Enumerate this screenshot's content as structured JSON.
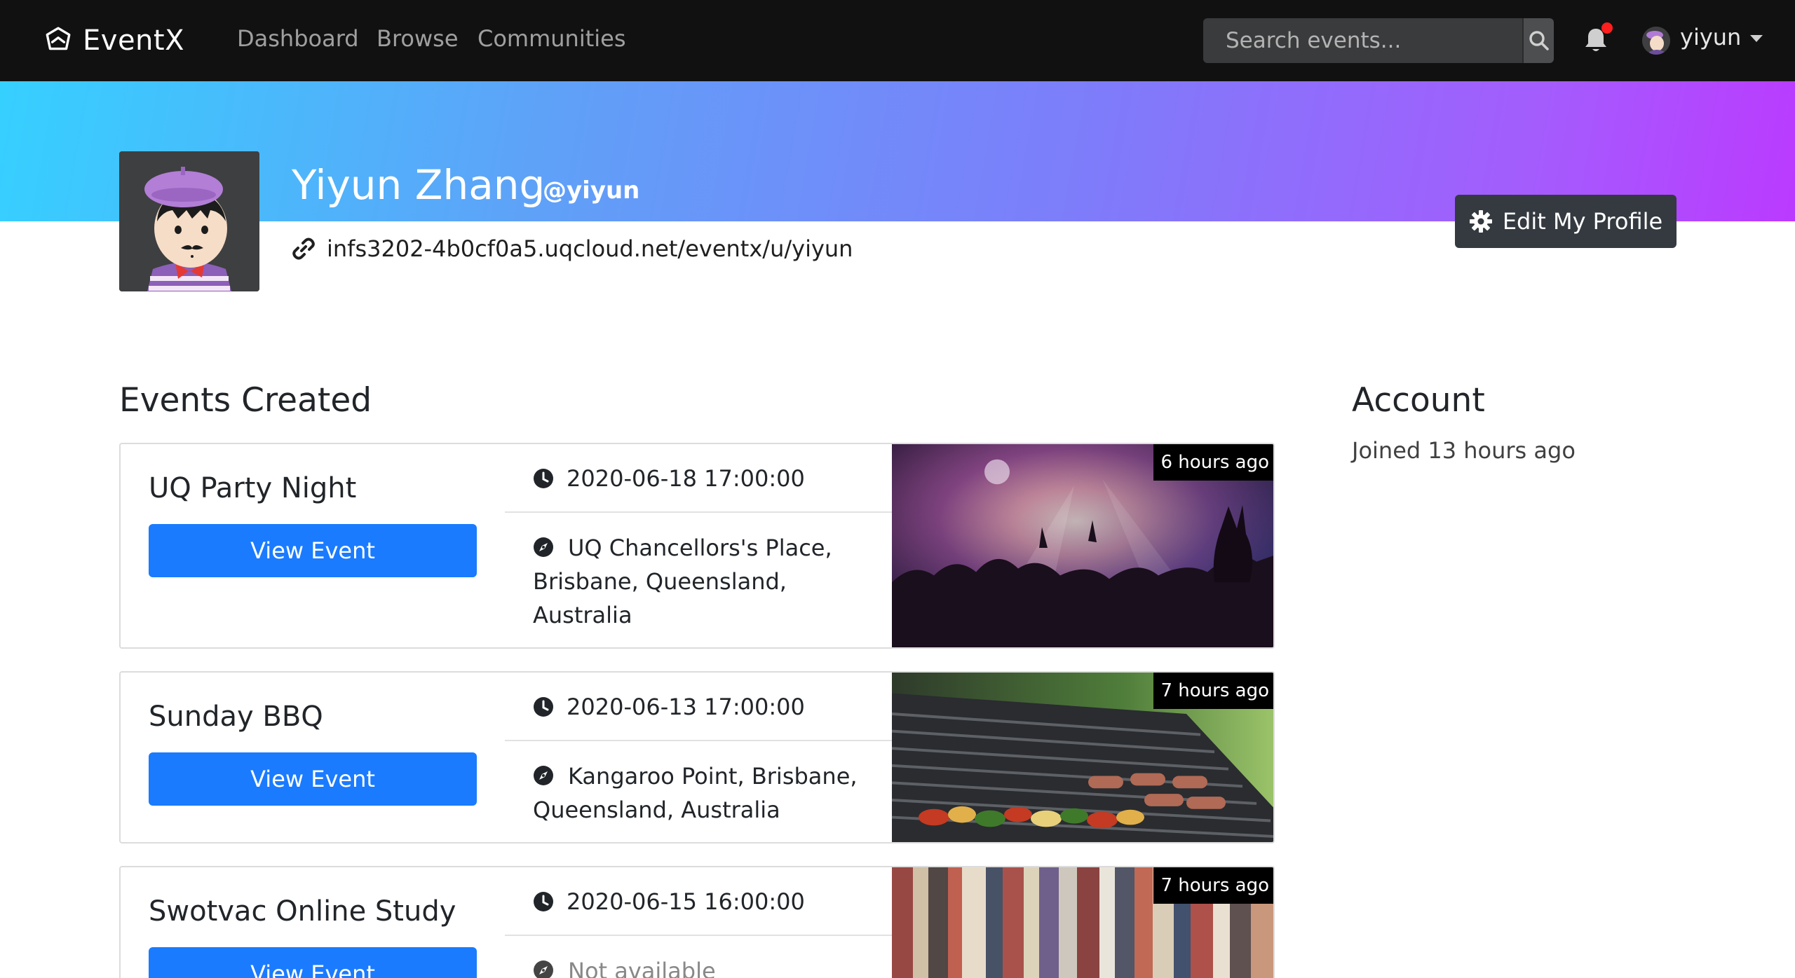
{
  "navbar": {
    "brand": "EventX",
    "links": [
      "Dashboard",
      "Browse",
      "Communities"
    ],
    "search_placeholder": "Search events...",
    "username": "yiyun"
  },
  "profile": {
    "name": "Yiyun Zhang",
    "handle": "@yiyun",
    "url": "infs3202-4b0cf0a5.uqcloud.net/eventx/u/yiyun",
    "edit_label": "Edit My Profile"
  },
  "events_section": {
    "title": "Events Created",
    "view_label": "View Event",
    "events": [
      {
        "title": "UQ Party Night",
        "date": "2020-06-18 17:00:00",
        "location": "UQ Chancellors's Place, Brisbane, Queensland, Australia",
        "time_ago": "6 hours ago",
        "image": "party-crowd"
      },
      {
        "title": "Sunday BBQ",
        "date": "2020-06-13 17:00:00",
        "location": "Kangaroo Point, Brisbane, Queensland, Australia",
        "time_ago": "7 hours ago",
        "image": "bbq-grill"
      },
      {
        "title": "Swotvac Online Study",
        "date": "2020-06-15 16:00:00",
        "location": "Not available",
        "time_ago": "7 hours ago",
        "image": "bookshelf"
      }
    ]
  },
  "account": {
    "title": "Account",
    "joined": "Joined 13 hours ago"
  },
  "colors": {
    "navbar_bg": "#111111",
    "primary": "#1a7bff",
    "edit_button": "#343a40",
    "gradient_start": "#36d0ff",
    "gradient_end": "#bb3aff",
    "notification_dot": "#ff1f1f"
  },
  "icons": [
    "eventx-logo-icon",
    "search-icon",
    "bell-icon",
    "link-icon",
    "gear-icon",
    "clock-icon",
    "compass-icon",
    "chevron-down-icon"
  ]
}
